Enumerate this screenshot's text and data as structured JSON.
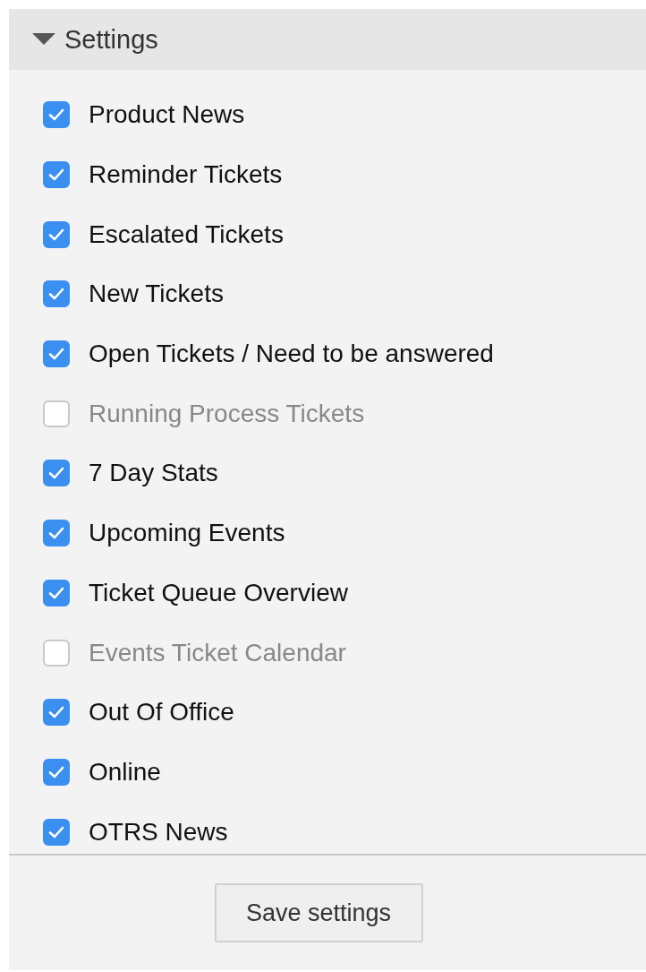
{
  "panel": {
    "title": "Settings",
    "expanded": true
  },
  "options": [
    {
      "label": "Product News",
      "checked": true
    },
    {
      "label": "Reminder Tickets",
      "checked": true
    },
    {
      "label": "Escalated Tickets",
      "checked": true
    },
    {
      "label": "New Tickets",
      "checked": true
    },
    {
      "label": "Open Tickets / Need to be answered",
      "checked": true
    },
    {
      "label": "Running Process Tickets",
      "checked": false
    },
    {
      "label": "7 Day Stats",
      "checked": true
    },
    {
      "label": "Upcoming Events",
      "checked": true
    },
    {
      "label": "Ticket Queue Overview",
      "checked": true
    },
    {
      "label": "Events Ticket Calendar",
      "checked": false
    },
    {
      "label": "Out Of Office",
      "checked": true
    },
    {
      "label": "Online",
      "checked": true
    },
    {
      "label": "OTRS News",
      "checked": true
    }
  ],
  "save_button": "Save settings"
}
